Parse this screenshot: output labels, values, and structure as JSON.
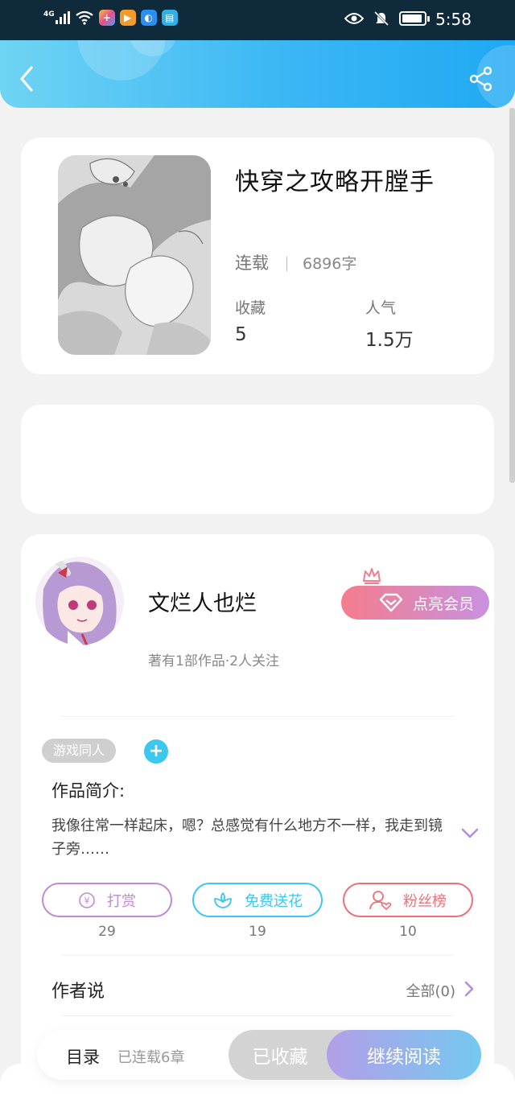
{
  "status_bar": {
    "network": "4G",
    "time": "5:58"
  },
  "book": {
    "title": "快穿之攻略开膛手",
    "status": "连载",
    "words": "6896字",
    "favorites_label": "收藏",
    "favorites_value": "5",
    "popularity_label": "人气",
    "popularity_value": "1.5万"
  },
  "author": {
    "name": "文烂人也烂",
    "meta": "著有1部作品·2人关注",
    "vip_button": "点亮会员"
  },
  "tags": [
    "游戏同人"
  ],
  "intro": {
    "title": "作品简介:",
    "text": "我像往常一样起床，嗯？总感觉有什么地方不一样，我走到镜子旁……"
  },
  "actions": [
    {
      "label": "打赏",
      "count": "29",
      "color": "#c08ad8",
      "icon": "coin-icon"
    },
    {
      "label": "免费送花",
      "count": "19",
      "color": "#3cc7ee",
      "icon": "flower-icon"
    },
    {
      "label": "粉丝榜",
      "count": "10",
      "color": "#ef6f79",
      "icon": "fan-icon"
    }
  ],
  "author_says": {
    "title": "作者说",
    "all": "全部(0)"
  },
  "bottom_bar": {
    "toc": "目录",
    "chapters": "已连载6章",
    "collected": "已收藏",
    "read": "继续阅读"
  },
  "colors": {
    "header_start": "#6fd4f3",
    "header_end": "#1fa9f3",
    "vip_start": "#f47d8d",
    "vip_end": "#c891e0",
    "read_start": "#b49ee8",
    "read_end": "#74c9f0"
  }
}
